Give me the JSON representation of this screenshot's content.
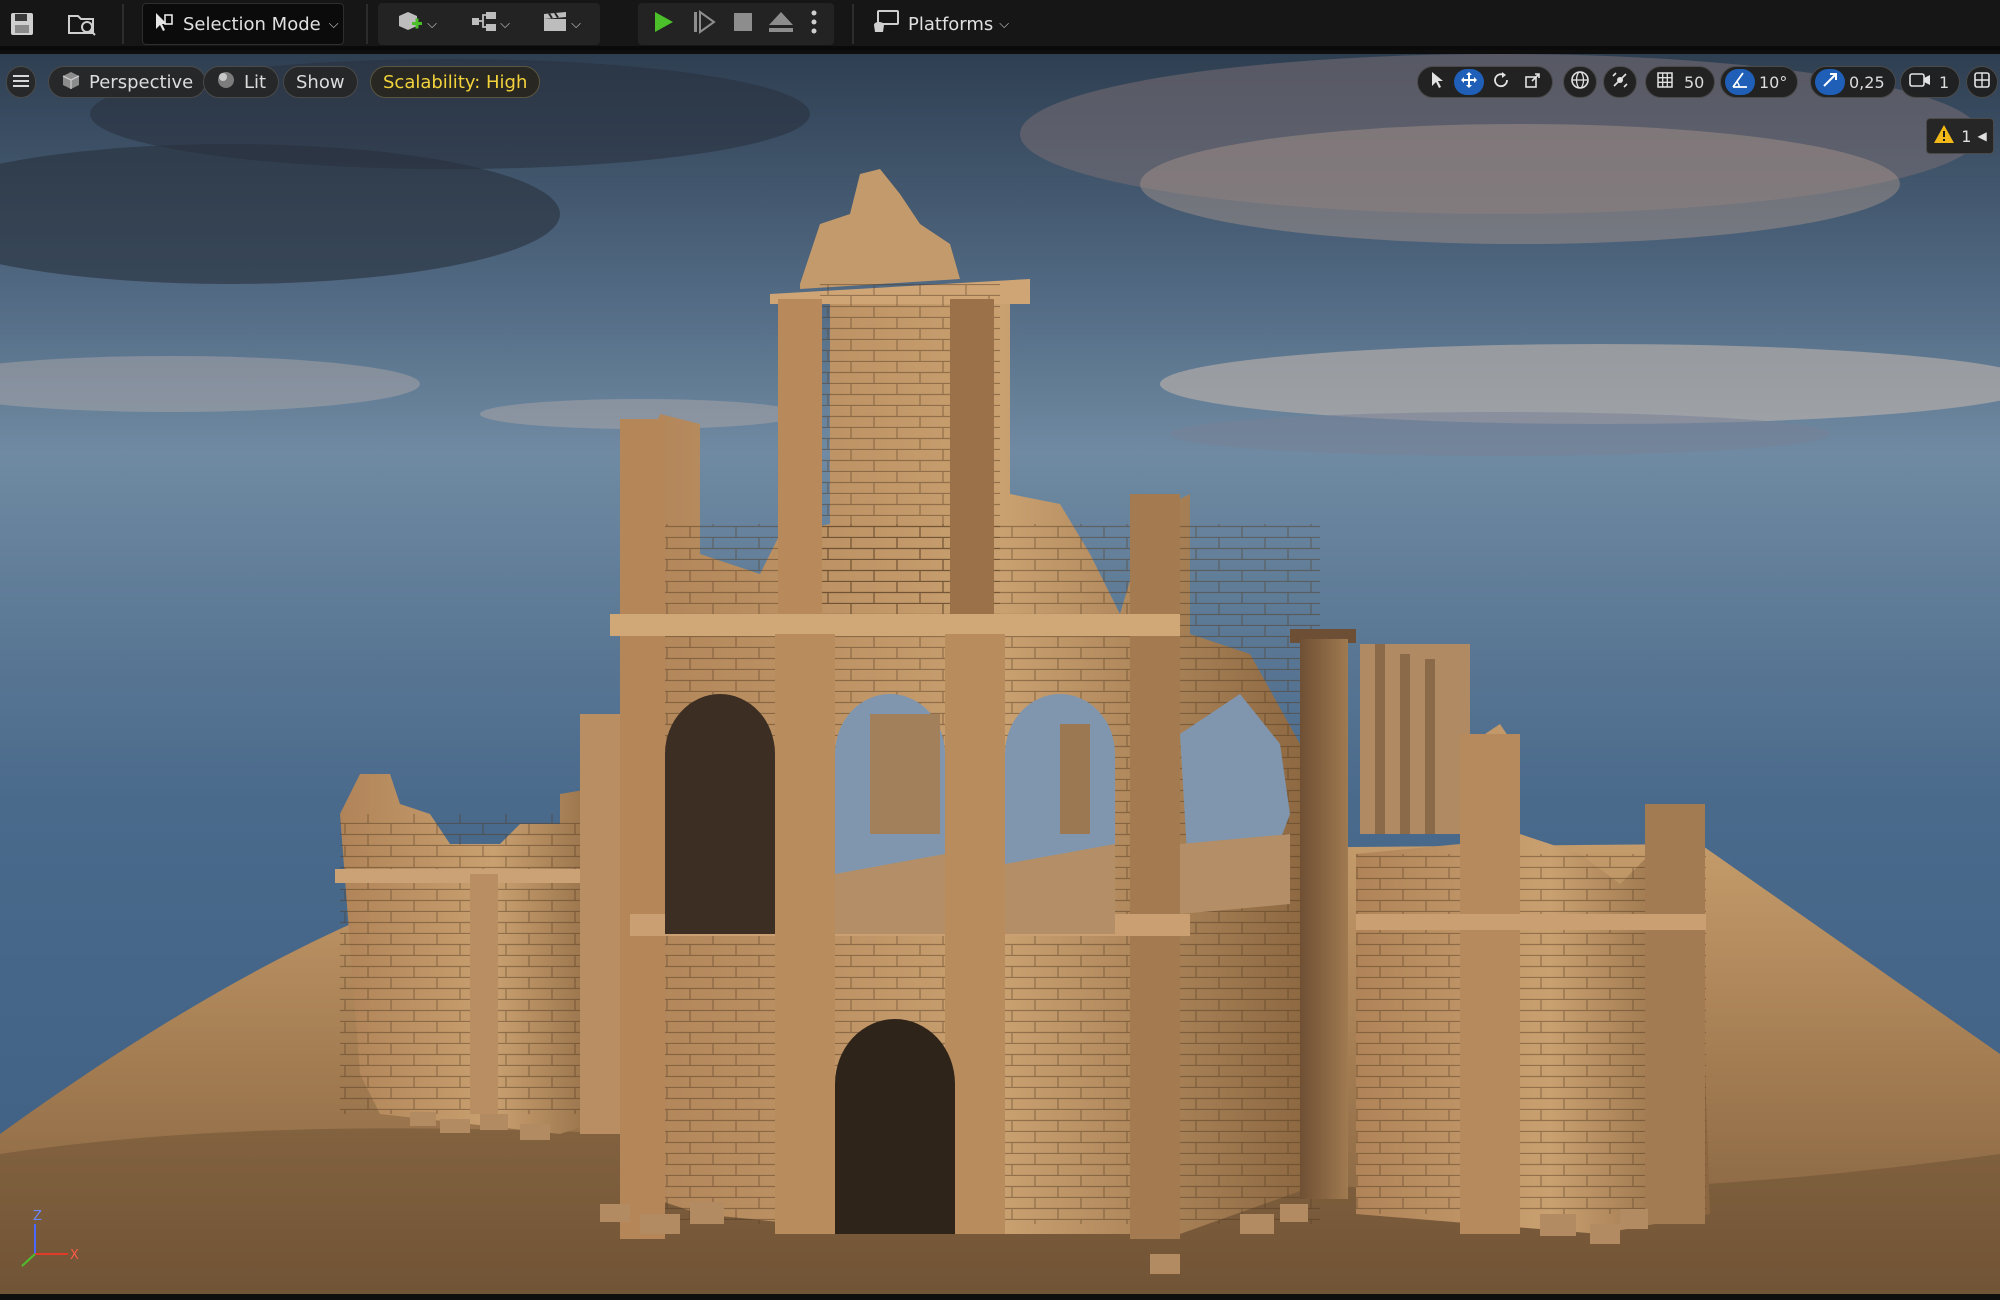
{
  "toolbar": {
    "selection_mode_label": "Selection Mode",
    "platforms_label": "Platforms",
    "icons": [
      "save-icon",
      "content-browser-icon",
      "selection-mode-icon",
      "add-actor-icon",
      "blueprint-icon",
      "cinematics-icon",
      "play-icon",
      "advance-frame-icon",
      "stop-icon",
      "eject-icon",
      "more-options-icon",
      "platforms-icon"
    ]
  },
  "viewport": {
    "perspective_label": "Perspective",
    "lit_label": "Lit",
    "show_label": "Show",
    "scalability_label": "Scalability: High",
    "grid_snap_value": "50",
    "rotation_snap_value": "10°",
    "scale_snap_value": "0,25",
    "camera_speed_value": "1",
    "warning_count": "1",
    "axis": {
      "z": "Z",
      "x": "X"
    }
  },
  "colors": {
    "accent_blue": "#1f5fb7",
    "scalability_yellow": "#f3d33c",
    "play_green": "#4cc02a",
    "warning_yellow": "#f2b817"
  }
}
